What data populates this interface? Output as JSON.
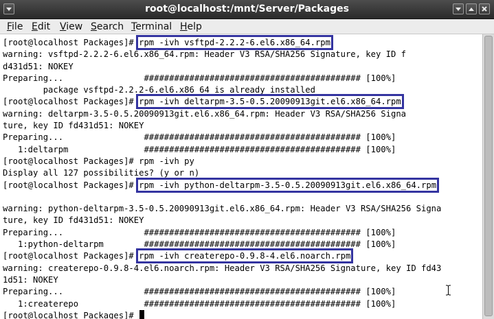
{
  "window": {
    "title": "root@localhost:/mnt/Server/Packages"
  },
  "menu": {
    "file": "File",
    "edit": "Edit",
    "view": "View",
    "search": "Search",
    "terminal": "Terminal",
    "help": "Help"
  },
  "terminal": {
    "lines": [
      {
        "prompt": "[root@localhost Packages]# ",
        "cmd": "rpm -ivh vsftpd-2.2.2-6.el6.x86_64.rpm",
        "highlight": true
      },
      {
        "text": "warning: vsftpd-2.2.2-6.el6.x86_64.rpm: Header V3 RSA/SHA256 Signature, key ID f"
      },
      {
        "text": "d431d51: NOKEY"
      },
      {
        "text": "Preparing...                ########################################### [100%]"
      },
      {
        "text": "        package vsftpd-2.2.2-6.el6.x86_64 is already installed"
      },
      {
        "prompt": "[root@localhost Packages]# ",
        "cmd": "rpm -ivh deltarpm-3.5-0.5.20090913git.el6.x86_64.rpm",
        "highlight": true
      },
      {
        "text": "warning: deltarpm-3.5-0.5.20090913git.el6.x86_64.rpm: Header V3 RSA/SHA256 Signa"
      },
      {
        "text": "ture, key ID fd431d51: NOKEY"
      },
      {
        "text": "Preparing...                ########################################### [100%]"
      },
      {
        "text": "   1:deltarpm               ########################################### [100%]"
      },
      {
        "prompt": "[root@localhost Packages]# ",
        "cmd": "rpm -ivh py",
        "highlight": false
      },
      {
        "text": "Display all 127 possibilities? (y or n)"
      },
      {
        "prompt": "[root@localhost Packages]# ",
        "cmd": "rpm -ivh python-deltarpm-3.5-0.5.20090913git.el6.x86_64.rpm",
        "highlight": true
      },
      {
        "text": ""
      },
      {
        "text": "warning: python-deltarpm-3.5-0.5.20090913git.el6.x86_64.rpm: Header V3 RSA/SHA256 Signa"
      },
      {
        "text": "ture, key ID fd431d51: NOKEY"
      },
      {
        "text": "Preparing...                ########################################### [100%]"
      },
      {
        "text": "   1:python-deltarpm        ########################################### [100%]"
      },
      {
        "prompt": "[root@localhost Packages]# ",
        "cmd": "rpm -ivh createrepo-0.9.8-4.el6.noarch.rpm",
        "highlight": true
      },
      {
        "text": "warning: createrepo-0.9.8-4.el6.noarch.rpm: Header V3 RSA/SHA256 Signature, key ID fd43"
      },
      {
        "text": "1d51: NOKEY"
      },
      {
        "text": "Preparing...                ########################################### [100%]"
      },
      {
        "text": "   1:createrepo             ########################################### [100%]"
      },
      {
        "prompt": "[root@localhost Packages]# ",
        "cmd": "",
        "highlight": false,
        "cursor": true
      }
    ]
  },
  "colors": {
    "highlight_box": "#3434a0",
    "titlebar": "#3a3a3a",
    "terminal_bg": "#ffffff",
    "terminal_fg": "#000000"
  },
  "icons": {
    "window_menu": "window-menu-icon",
    "minimize": "minimize-icon",
    "maximize": "maximize-icon",
    "close": "close-icon",
    "text_cursor": "ibeam-cursor-icon"
  }
}
